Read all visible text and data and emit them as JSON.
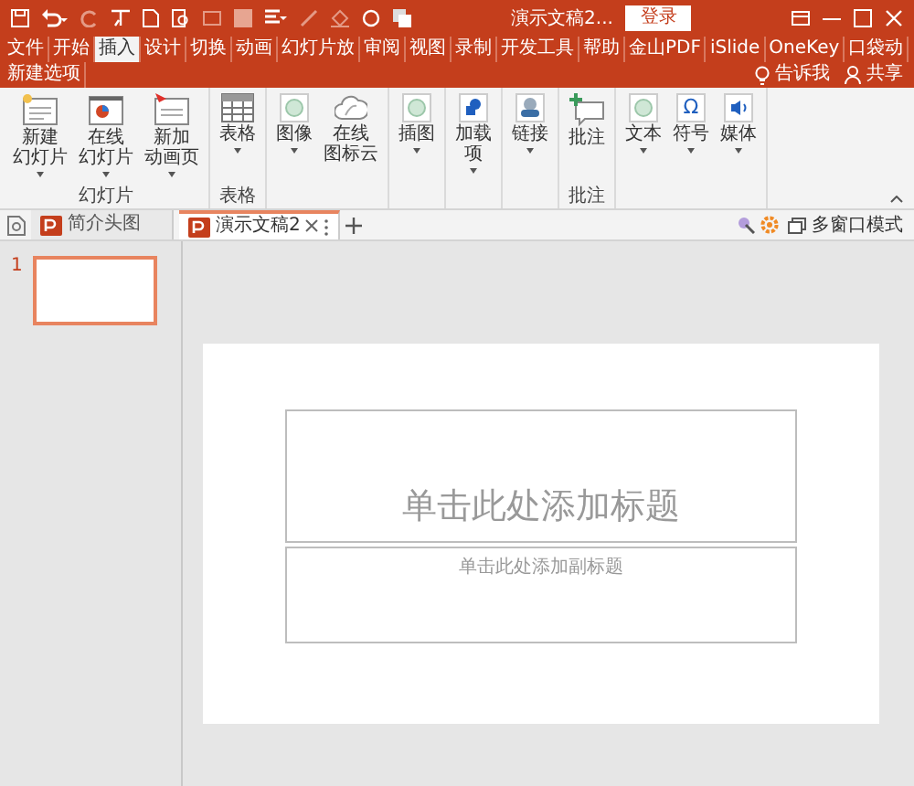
{
  "title_bar": {
    "title": "演示文稿2...",
    "login": "登录"
  },
  "ribbon_tabs": [
    {
      "label": "文件",
      "selected": false
    },
    {
      "label": "开始",
      "selected": false
    },
    {
      "label": "插入",
      "selected": true
    },
    {
      "label": "设计",
      "selected": false
    },
    {
      "label": "切换",
      "selected": false
    },
    {
      "label": "动画",
      "selected": false
    },
    {
      "label": "幻灯片放",
      "selected": false
    },
    {
      "label": "审阅",
      "selected": false
    },
    {
      "label": "视图",
      "selected": false
    },
    {
      "label": "录制",
      "selected": false
    },
    {
      "label": "开发工具",
      "selected": false
    },
    {
      "label": "帮助",
      "selected": false
    },
    {
      "label": "金山PDF",
      "selected": false
    },
    {
      "label": "iSlide",
      "selected": false
    },
    {
      "label": "OneKey",
      "selected": false
    },
    {
      "label": "口袋动",
      "selected": false
    },
    {
      "label": "新建选项",
      "selected": false
    }
  ],
  "tell_me": "告诉我",
  "share": "共享",
  "ribbon_groups": [
    {
      "label": "幻灯片",
      "buttons": [
        {
          "lines": [
            "新建",
            "幻灯片"
          ],
          "dropdown": true
        },
        {
          "lines": [
            "在线",
            "幻灯片"
          ],
          "dropdown": true
        },
        {
          "lines": [
            "新加",
            "动画页"
          ],
          "dropdown": true
        }
      ]
    },
    {
      "label": "表格",
      "buttons": [
        {
          "label": "表格",
          "dropdown": true
        }
      ]
    },
    {
      "buttons": [
        {
          "label": "图像",
          "dropdown": true
        },
        {
          "lines": [
            "在线",
            "图标云"
          ],
          "dropdown": false
        }
      ]
    },
    {
      "buttons": [
        {
          "label": "插图",
          "dropdown": true
        }
      ]
    },
    {
      "buttons": [
        {
          "lines": [
            "加载",
            "项"
          ],
          "dropdown": true
        }
      ]
    },
    {
      "buttons": [
        {
          "label": "链接",
          "dropdown": true
        }
      ]
    },
    {
      "label": "批注",
      "buttons": [
        {
          "label": "批注",
          "dropdown": false
        }
      ]
    },
    {
      "buttons": [
        {
          "label": "文本",
          "dropdown": true
        },
        {
          "label": "符号",
          "dropdown": true,
          "glyph": "Ω"
        },
        {
          "label": "媒体",
          "dropdown": true
        }
      ]
    }
  ],
  "doc_tabs": [
    {
      "label": "简介头图",
      "selected": false
    },
    {
      "label": "演示文稿2",
      "selected": true
    }
  ],
  "multi_window": "多窗口模式",
  "thumbnails": [
    {
      "number": "1",
      "selected": true
    }
  ],
  "slide": {
    "title_placeholder": "单击此处添加标题",
    "subtitle_placeholder": "单击此处添加副标题"
  }
}
